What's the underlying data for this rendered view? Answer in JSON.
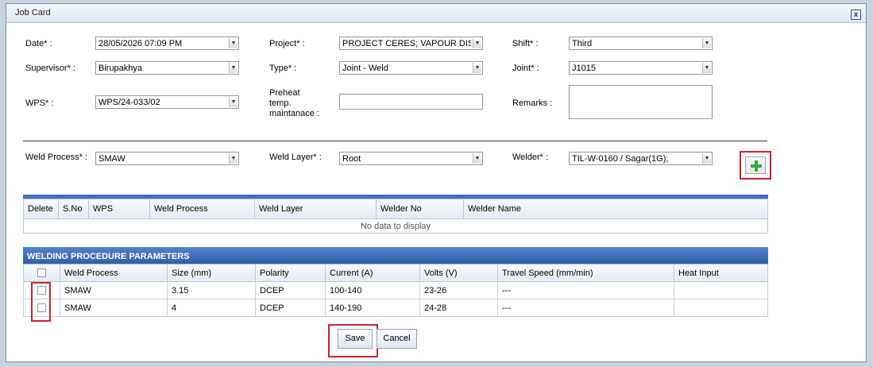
{
  "dialog": {
    "title": "Job Card",
    "close_label": "x"
  },
  "form": {
    "date": {
      "label": "Date* :",
      "value": "28/05/2026 07:09 PM"
    },
    "project": {
      "label": "Project* :",
      "value": "PROJECT CERES; VAPOUR DISENG"
    },
    "shift": {
      "label": "Shift* :",
      "value": "Third"
    },
    "supervisor": {
      "label": "Supervisor* :",
      "value": "Birupakhya"
    },
    "type": {
      "label": "Type* :",
      "value": "Joint - Weld"
    },
    "joint": {
      "label": "Joint* :",
      "value": "J1015"
    },
    "wps": {
      "label": "WPS* :",
      "value": "WPS/24-033/02"
    },
    "preheat": {
      "label_line1": "Preheat",
      "label_line2": "temp.",
      "label_line3": "maintanace :",
      "value": ""
    },
    "remarks": {
      "label": "Remarks :",
      "value": ""
    },
    "weld_process": {
      "label": "Weld Process* :",
      "value": "SMAW"
    },
    "weld_layer": {
      "label": "Weld Layer* :",
      "value": "Root"
    },
    "welder": {
      "label": "Welder* :",
      "value": "TIL-W-0160 / Sagar(1G);"
    }
  },
  "welder_grid": {
    "columns": [
      "Delete",
      "S.No",
      "WPS",
      "Weld Process",
      "Weld Layer",
      "Welder No",
      "Welder Name"
    ],
    "empty_text": "No data to display"
  },
  "params_grid": {
    "title": "WELDING PROCEDURE PARAMETERS",
    "columns": [
      "",
      "Weld Process",
      "Size (mm)",
      "Polarity",
      "Current (A)",
      "Volts (V)",
      "Travel Speed (mm/min)",
      "Heat Input"
    ],
    "rows": [
      {
        "process": "SMAW",
        "size": "3.15",
        "polarity": "DCEP",
        "current": "100-140",
        "volts": "23-26",
        "speed": "---",
        "heat": ""
      },
      {
        "process": "SMAW",
        "size": "4",
        "polarity": "DCEP",
        "current": "140-190",
        "volts": "24-28",
        "speed": "---",
        "heat": ""
      }
    ]
  },
  "buttons": {
    "save": "Save",
    "cancel": "Cancel"
  },
  "colors": {
    "grid_header_blue": "#3d6fb8",
    "highlight_red": "#d0202a",
    "plus_green": "#3aa73a"
  },
  "icons": {
    "add": "plus-icon",
    "dropdown": "chevron-down-icon",
    "close": "close-icon"
  }
}
